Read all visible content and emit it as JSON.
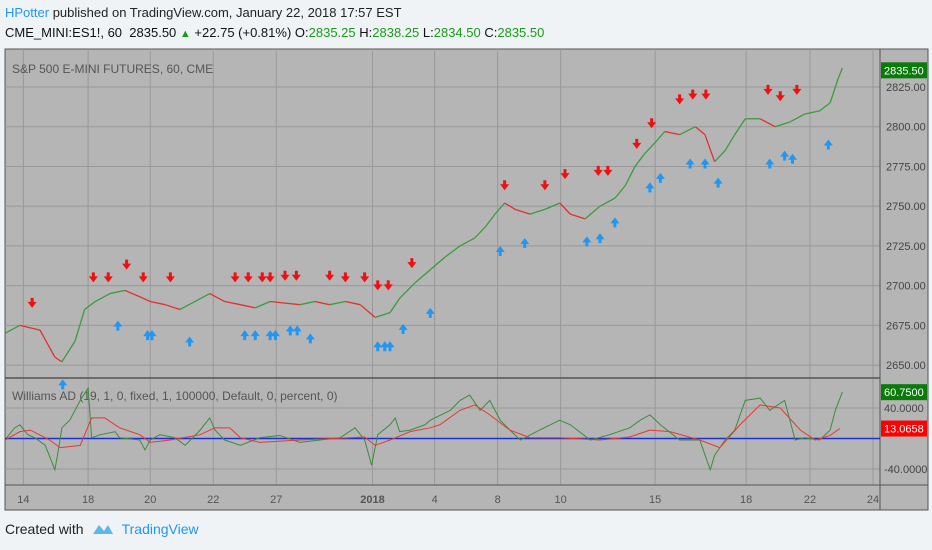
{
  "header": {
    "user": "HPotter",
    "published": "published on TradingView.com, January 22, 2018 17:57 EST"
  },
  "quote": {
    "symbol": "CME_MINI:ES1!, 60",
    "last": "2835.50",
    "change": "+22.75 (+0.81%)",
    "o_label": "O:",
    "o": "2835.25",
    "h_label": "H:",
    "h": "2838.25",
    "l_label": "L:",
    "l": "2834.50",
    "c_label": "C:",
    "c": "2835.50"
  },
  "colors": {
    "bg": "#b5b5b5",
    "up": "#3c9b3c",
    "down": "#e03030",
    "buy": "#2196f3",
    "sell": "#ee1111",
    "ad": "#3c8c3c",
    "ma": "#e53935",
    "zero": "#1f2fd0"
  },
  "footer": {
    "created": "Created with",
    "brand": "TradingView"
  },
  "chart_data": [
    {
      "type": "line",
      "title": "S&P 500 E-MINI FUTURES, 60, CME",
      "ylim": [
        2640,
        2845
      ],
      "y_ticks": [
        "2825.00",
        "2800.00",
        "2775.00",
        "2750.00",
        "2725.00",
        "2700.00",
        "2675.00",
        "2650.00"
      ],
      "last_label": "2835.50",
      "x_ticks": [
        {
          "t": 2.1,
          "label": "14"
        },
        {
          "t": 9.5,
          "label": "18"
        },
        {
          "t": 16.6,
          "label": "20"
        },
        {
          "t": 23.8,
          "label": "22"
        },
        {
          "t": 31,
          "label": "27"
        },
        {
          "t": 42,
          "label": "2018"
        },
        {
          "t": 49.1,
          "label": "4"
        },
        {
          "t": 56.3,
          "label": "8"
        },
        {
          "t": 63.5,
          "label": "10"
        },
        {
          "t": 74.3,
          "label": "15"
        },
        {
          "t": 84.7,
          "label": "18"
        },
        {
          "t": 92,
          "label": "22"
        },
        {
          "t": 99.2,
          "label": "24"
        }
      ],
      "points": [
        [
          0,
          2670
        ],
        [
          1.7,
          2675
        ],
        [
          4,
          2672
        ],
        [
          5.7,
          2655
        ],
        [
          6.5,
          2652
        ],
        [
          8,
          2665
        ],
        [
          9.1,
          2685
        ],
        [
          10.3,
          2690
        ],
        [
          12,
          2695
        ],
        [
          13.7,
          2697
        ],
        [
          15.4,
          2693
        ],
        [
          16.6,
          2690
        ],
        [
          18.3,
          2688
        ],
        [
          20,
          2685
        ],
        [
          21.7,
          2690
        ],
        [
          23.4,
          2695
        ],
        [
          25.1,
          2690
        ],
        [
          26.9,
          2688
        ],
        [
          28.6,
          2686
        ],
        [
          30.3,
          2690
        ],
        [
          32,
          2689
        ],
        [
          33.7,
          2688
        ],
        [
          35.4,
          2690
        ],
        [
          37.1,
          2688
        ],
        [
          38.9,
          2690
        ],
        [
          40.6,
          2688
        ],
        [
          42.3,
          2680
        ],
        [
          44,
          2683
        ],
        [
          45.1,
          2692
        ],
        [
          46.9,
          2702
        ],
        [
          48.6,
          2710
        ],
        [
          50.3,
          2718
        ],
        [
          52,
          2725
        ],
        [
          53.7,
          2730
        ],
        [
          54.9,
          2737
        ],
        [
          56,
          2745
        ],
        [
          57.1,
          2752
        ],
        [
          58.3,
          2748
        ],
        [
          60,
          2745
        ],
        [
          61.7,
          2748
        ],
        [
          63.4,
          2752
        ],
        [
          64.6,
          2745
        ],
        [
          66.3,
          2742
        ],
        [
          68,
          2750
        ],
        [
          69.7,
          2755
        ],
        [
          70.9,
          2763
        ],
        [
          72,
          2775
        ],
        [
          73.1,
          2783
        ],
        [
          74.3,
          2790
        ],
        [
          75.4,
          2797
        ],
        [
          77.1,
          2795
        ],
        [
          78.9,
          2800
        ],
        [
          80,
          2795
        ],
        [
          81.1,
          2778
        ],
        [
          82.3,
          2785
        ],
        [
          83.4,
          2795
        ],
        [
          84.6,
          2805
        ],
        [
          86.3,
          2805
        ],
        [
          88,
          2800
        ],
        [
          89.7,
          2803
        ],
        [
          91.4,
          2808
        ],
        [
          93.1,
          2810
        ],
        [
          94.3,
          2815
        ],
        [
          95.2,
          2830
        ],
        [
          95.7,
          2837
        ]
      ],
      "sell_signals": [
        [
          3.1,
          2681
        ],
        [
          10.1,
          2697
        ],
        [
          11.8,
          2697
        ],
        [
          13.9,
          2705
        ],
        [
          15.8,
          2697
        ],
        [
          18.9,
          2697
        ],
        [
          26.3,
          2697
        ],
        [
          27.8,
          2697
        ],
        [
          29.4,
          2697
        ],
        [
          30.3,
          2697
        ],
        [
          32,
          2698
        ],
        [
          33.3,
          2698
        ],
        [
          37.1,
          2698
        ],
        [
          38.9,
          2697
        ],
        [
          41.1,
          2697
        ],
        [
          42.6,
          2692
        ],
        [
          43.8,
          2692
        ],
        [
          46.5,
          2706
        ],
        [
          57.1,
          2755
        ],
        [
          61.7,
          2755
        ],
        [
          64,
          2762
        ],
        [
          67.8,
          2764
        ],
        [
          68.9,
          2764
        ],
        [
          72.2,
          2781
        ],
        [
          73.9,
          2794
        ],
        [
          77.1,
          2809
        ],
        [
          78.6,
          2812
        ],
        [
          80.1,
          2812
        ],
        [
          87.2,
          2815
        ],
        [
          88.6,
          2811
        ],
        [
          90.5,
          2815
        ]
      ],
      "buy_signals": [
        [
          6.6,
          2646
        ],
        [
          12.9,
          2683
        ],
        [
          16.3,
          2677
        ],
        [
          16.8,
          2677
        ],
        [
          21.1,
          2673
        ],
        [
          27.4,
          2677
        ],
        [
          28.6,
          2677
        ],
        [
          30.3,
          2677
        ],
        [
          30.9,
          2677
        ],
        [
          32.6,
          2680
        ],
        [
          33.4,
          2680
        ],
        [
          34.9,
          2675
        ],
        [
          42.6,
          2670
        ],
        [
          43.4,
          2670
        ],
        [
          44,
          2670
        ],
        [
          45.5,
          2681
        ],
        [
          48.6,
          2691
        ],
        [
          56.6,
          2730
        ],
        [
          59.4,
          2735
        ],
        [
          66.5,
          2736
        ],
        [
          68,
          2738
        ],
        [
          69.7,
          2748
        ],
        [
          73.7,
          2770
        ],
        [
          74.9,
          2776
        ],
        [
          78.3,
          2785
        ],
        [
          80,
          2785
        ],
        [
          81.5,
          2773
        ],
        [
          87.4,
          2785
        ],
        [
          89.1,
          2790
        ],
        [
          90,
          2788
        ],
        [
          94.1,
          2797
        ]
      ]
    },
    {
      "type": "line",
      "title": "Williams AD (19, 1, 0, fixed, 1, 100000, Default, 0, percent, 0)",
      "ylim": [
        -55,
        75
      ],
      "y_ticks": [
        "40.0000",
        "-40.0000"
      ],
      "last_ad": "60.7500",
      "last_ma": "13.0658",
      "zero_line": 0,
      "series": [
        {
          "name": "AD",
          "values": [
            [
              0.2,
              1
            ],
            [
              1.1,
              14
            ],
            [
              1.7,
              18
            ],
            [
              2.6,
              5
            ],
            [
              3.4,
              1
            ],
            [
              4.6,
              -9
            ],
            [
              5.7,
              -41
            ],
            [
              6.1,
              -15
            ],
            [
              6.5,
              14
            ],
            [
              7.4,
              24
            ],
            [
              8.6,
              50
            ],
            [
              9.5,
              66
            ],
            [
              9.9,
              1
            ],
            [
              10.9,
              5
            ],
            [
              12.6,
              9
            ],
            [
              13.1,
              1
            ],
            [
              15.4,
              -2
            ],
            [
              16,
              -15
            ],
            [
              16.6,
              -2
            ],
            [
              17.7,
              5
            ],
            [
              19.4,
              1
            ],
            [
              20.6,
              -9
            ],
            [
              22.3,
              11
            ],
            [
              23.4,
              27
            ],
            [
              24,
              11
            ],
            [
              25.1,
              -2
            ],
            [
              26.9,
              -9
            ],
            [
              29.1,
              1
            ],
            [
              31.4,
              4
            ],
            [
              33.7,
              -5
            ],
            [
              36,
              -2
            ],
            [
              38.3,
              1
            ],
            [
              40,
              14
            ],
            [
              41.1,
              -2
            ],
            [
              41.9,
              -35
            ],
            [
              42.6,
              5
            ],
            [
              44,
              18
            ],
            [
              44.6,
              27
            ],
            [
              45.1,
              9
            ],
            [
              46.3,
              11
            ],
            [
              48,
              18
            ],
            [
              48.6,
              24
            ],
            [
              50.9,
              37
            ],
            [
              52,
              50
            ],
            [
              53.1,
              57
            ],
            [
              54.3,
              37
            ],
            [
              55.4,
              50
            ],
            [
              56.6,
              24
            ],
            [
              57.7,
              11
            ],
            [
              58.9,
              -2
            ],
            [
              61.1,
              11
            ],
            [
              63.4,
              24
            ],
            [
              64.6,
              18
            ],
            [
              66.9,
              -2
            ],
            [
              69.1,
              5
            ],
            [
              71.4,
              14
            ],
            [
              72.6,
              24
            ],
            [
              73.7,
              31
            ],
            [
              74.9,
              18
            ],
            [
              77.1,
              -2
            ],
            [
              79.4,
              -2
            ],
            [
              80.6,
              -41
            ],
            [
              81.1,
              -22
            ],
            [
              82.3,
              -2
            ],
            [
              83.4,
              11
            ],
            [
              84.6,
              50
            ],
            [
              86.3,
              53
            ],
            [
              87.4,
              37
            ],
            [
              89.1,
              50
            ],
            [
              90.3,
              -2
            ],
            [
              91.4,
              1
            ],
            [
              93.1,
              -2
            ],
            [
              94.3,
              11
            ],
            [
              94.9,
              37
            ],
            [
              95.7,
              61
            ]
          ]
        },
        {
          "name": "MA",
          "values": [
            [
              0,
              -2
            ],
            [
              1.7,
              9
            ],
            [
              2.9,
              11
            ],
            [
              5.1,
              -2
            ],
            [
              6.3,
              -12
            ],
            [
              8.6,
              -9
            ],
            [
              9.9,
              27
            ],
            [
              11.4,
              27
            ],
            [
              13.1,
              14
            ],
            [
              15.4,
              5
            ],
            [
              16.6,
              -5
            ],
            [
              18.9,
              -2
            ],
            [
              22.3,
              5
            ],
            [
              24,
              14
            ],
            [
              25.7,
              14
            ],
            [
              26.9,
              1
            ],
            [
              29.1,
              -5
            ],
            [
              33.7,
              -2
            ],
            [
              39.4,
              1
            ],
            [
              41.1,
              2
            ],
            [
              42.3,
              -9
            ],
            [
              44,
              -2
            ],
            [
              46.3,
              9
            ],
            [
              48.6,
              14
            ],
            [
              49.7,
              18
            ],
            [
              52,
              37
            ],
            [
              53.7,
              44
            ],
            [
              55.4,
              31
            ],
            [
              57.7,
              11
            ],
            [
              60,
              1
            ],
            [
              63.4,
              1
            ],
            [
              68,
              -2
            ],
            [
              71.4,
              2
            ],
            [
              73.7,
              11
            ],
            [
              76,
              9
            ],
            [
              79.4,
              -2
            ],
            [
              81.7,
              -12
            ],
            [
              84,
              18
            ],
            [
              86.3,
              44
            ],
            [
              88.6,
              40
            ],
            [
              90.9,
              11
            ],
            [
              92.6,
              -2
            ],
            [
              94.3,
              4
            ],
            [
              95.4,
              13
            ]
          ]
        }
      ]
    }
  ]
}
